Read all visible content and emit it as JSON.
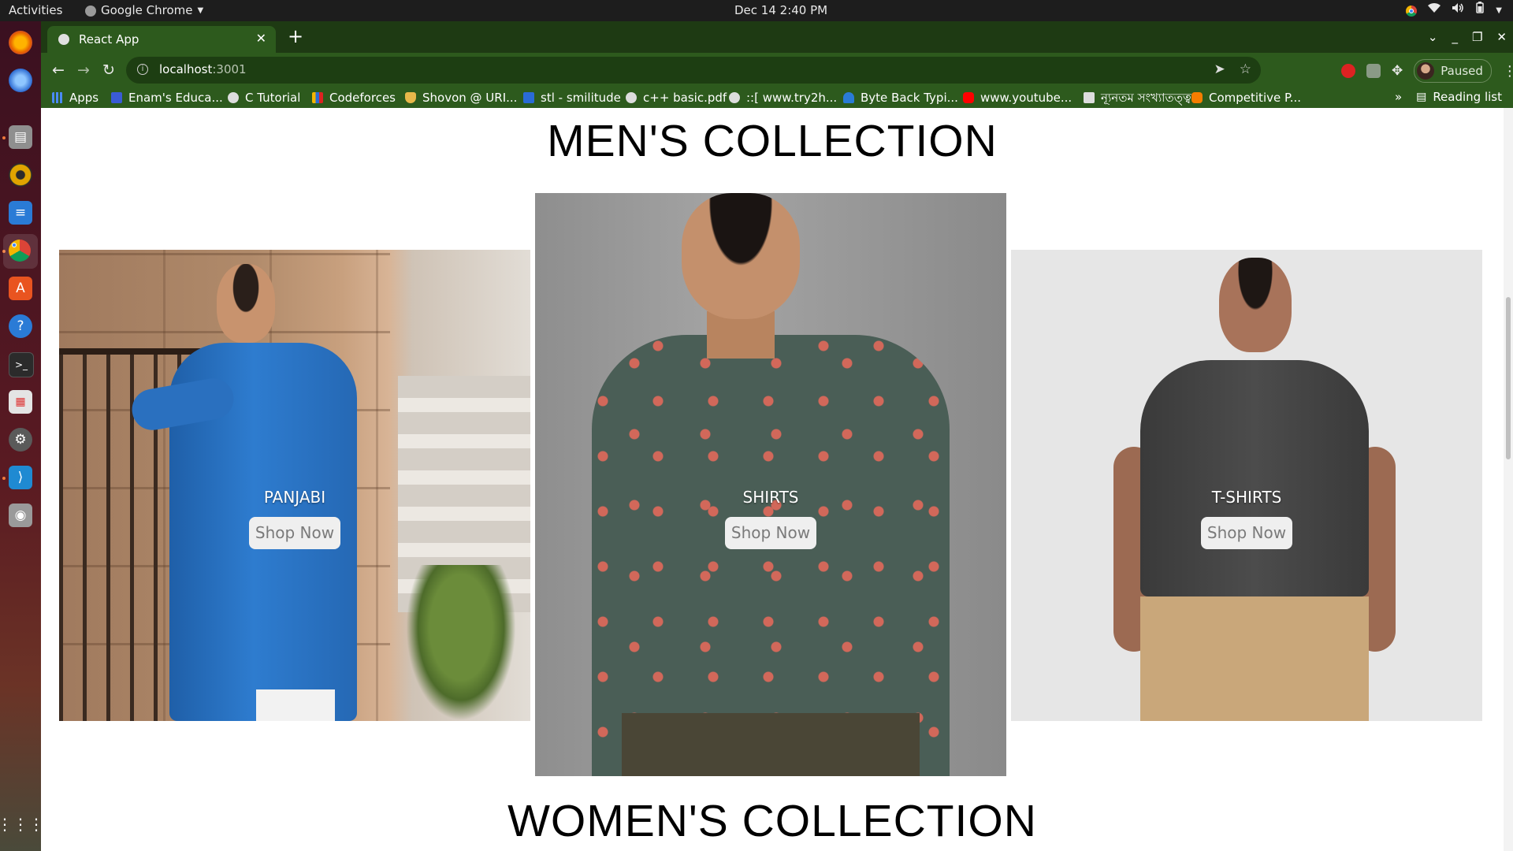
{
  "system_bar": {
    "activities": "Activities",
    "app_name": "Google Chrome",
    "app_menu_icon": "triangle-down-icon",
    "clock": "Dec 14  2:40 PM",
    "status_icons": [
      "chrome-icon",
      "wifi-icon",
      "volume-icon",
      "battery-icon",
      "system-menu-icon"
    ]
  },
  "dock": {
    "apps": [
      {
        "name": "firefox",
        "icon": "firefox-icon",
        "color": "#e66000"
      },
      {
        "name": "thunderbird",
        "icon": "thunderbird-icon",
        "color": "#2d6bd1"
      },
      {
        "name": "files",
        "icon": "files-icon",
        "color": "#8a8a8a"
      },
      {
        "name": "rhythmbox",
        "icon": "rhythmbox-icon",
        "color": "#e0a400"
      },
      {
        "name": "writer",
        "icon": "writer-icon",
        "color": "#2a7bd6"
      },
      {
        "name": "chrome",
        "icon": "chrome-icon",
        "color": "#4285f4"
      },
      {
        "name": "software",
        "icon": "software-center-icon",
        "color": "#e95420"
      },
      {
        "name": "help",
        "icon": "help-icon",
        "color": "#2a7bd6"
      },
      {
        "name": "terminal",
        "icon": "terminal-icon",
        "color": "#2b2b2b"
      },
      {
        "name": "document-viewer",
        "icon": "document-viewer-icon",
        "color": "#d9d9d9"
      },
      {
        "name": "settings",
        "icon": "settings-icon",
        "color": "#6a6a6a"
      },
      {
        "name": "vscode",
        "icon": "vscode-icon",
        "color": "#1f8ad2"
      },
      {
        "name": "disk",
        "icon": "disk-icon",
        "color": "#8a8a8a"
      }
    ],
    "show_apps_icon": "grid-icon"
  },
  "browser": {
    "tab": {
      "title": "React App",
      "favicon": "react-favicon-icon",
      "close": "✕"
    },
    "new_tab": "+",
    "url_host": "localhost",
    "url_port": ":3001",
    "profile_label": "Paused",
    "bookmarks": [
      {
        "label": "Apps",
        "icon": "apps-grid-icon",
        "color": "#4a8af4"
      },
      {
        "label": "Enam's Educa...",
        "icon": "enam-favicon-icon",
        "color": "#3a5bd6"
      },
      {
        "label": "C Tutorial",
        "icon": "c-tutorial-icon",
        "color": "#dddddd"
      },
      {
        "label": "Codeforces",
        "icon": "codeforces-icon",
        "color": "#f4b400"
      },
      {
        "label": "Shovon @ URI...",
        "icon": "trophy-icon",
        "color": "#e8b84a"
      },
      {
        "label": "stl - smilitude",
        "icon": "stl-icon",
        "color": "#2a6bd6"
      },
      {
        "label": "c++ basic.pdf",
        "icon": "globe-icon",
        "color": "#dddddd"
      },
      {
        "label": "::[ www.try2h...",
        "icon": "globe-icon",
        "color": "#dddddd"
      },
      {
        "label": "Byte Back Typi...",
        "icon": "byteback-icon",
        "color": "#2a7bd6"
      },
      {
        "label": "www.youtube...",
        "icon": "youtube-icon",
        "color": "#ff0000"
      },
      {
        "label": "ন্যূনতম সংখ্যাতত্ত্ব",
        "icon": "doc-icon",
        "color": "#dddddd"
      },
      {
        "label": "Competitive P...",
        "icon": "blogger-icon",
        "color": "#f57d00"
      }
    ],
    "overflow": "»",
    "reading_list": "Reading list"
  },
  "page": {
    "men_title": "MEN'S COLLECTION",
    "women_title": "WOMEN'S COLLECTION",
    "cards": [
      {
        "category": "PANJABI",
        "button": "Shop Now"
      },
      {
        "category": "SHIRTS",
        "button": "Shop Now"
      },
      {
        "category": "T-SHIRTS",
        "button": "Shop Now"
      }
    ]
  }
}
